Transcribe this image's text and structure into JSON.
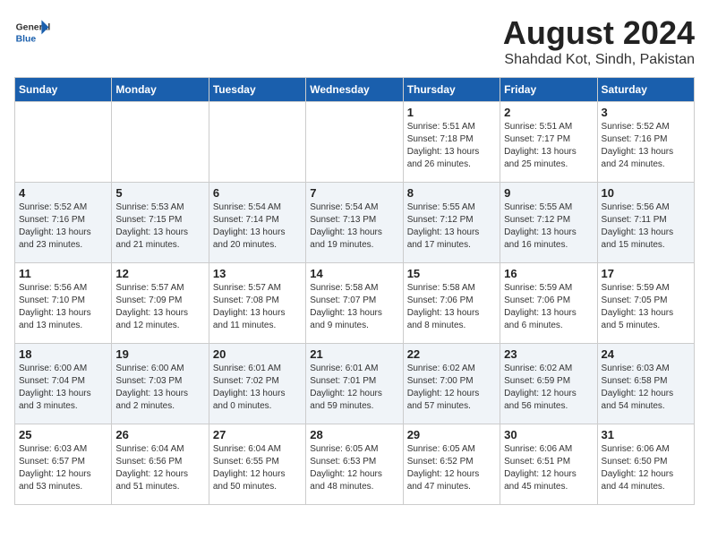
{
  "logo": {
    "general": "General",
    "blue": "Blue"
  },
  "title": "August 2024",
  "subtitle": "Shahdad Kot, Sindh, Pakistan",
  "weekdays": [
    "Sunday",
    "Monday",
    "Tuesday",
    "Wednesday",
    "Thursday",
    "Friday",
    "Saturday"
  ],
  "weeks": [
    [
      {
        "day": "",
        "info": ""
      },
      {
        "day": "",
        "info": ""
      },
      {
        "day": "",
        "info": ""
      },
      {
        "day": "",
        "info": ""
      },
      {
        "day": "1",
        "info": "Sunrise: 5:51 AM\nSunset: 7:18 PM\nDaylight: 13 hours\nand 26 minutes."
      },
      {
        "day": "2",
        "info": "Sunrise: 5:51 AM\nSunset: 7:17 PM\nDaylight: 13 hours\nand 25 minutes."
      },
      {
        "day": "3",
        "info": "Sunrise: 5:52 AM\nSunset: 7:16 PM\nDaylight: 13 hours\nand 24 minutes."
      }
    ],
    [
      {
        "day": "4",
        "info": "Sunrise: 5:52 AM\nSunset: 7:16 PM\nDaylight: 13 hours\nand 23 minutes."
      },
      {
        "day": "5",
        "info": "Sunrise: 5:53 AM\nSunset: 7:15 PM\nDaylight: 13 hours\nand 21 minutes."
      },
      {
        "day": "6",
        "info": "Sunrise: 5:54 AM\nSunset: 7:14 PM\nDaylight: 13 hours\nand 20 minutes."
      },
      {
        "day": "7",
        "info": "Sunrise: 5:54 AM\nSunset: 7:13 PM\nDaylight: 13 hours\nand 19 minutes."
      },
      {
        "day": "8",
        "info": "Sunrise: 5:55 AM\nSunset: 7:12 PM\nDaylight: 13 hours\nand 17 minutes."
      },
      {
        "day": "9",
        "info": "Sunrise: 5:55 AM\nSunset: 7:12 PM\nDaylight: 13 hours\nand 16 minutes."
      },
      {
        "day": "10",
        "info": "Sunrise: 5:56 AM\nSunset: 7:11 PM\nDaylight: 13 hours\nand 15 minutes."
      }
    ],
    [
      {
        "day": "11",
        "info": "Sunrise: 5:56 AM\nSunset: 7:10 PM\nDaylight: 13 hours\nand 13 minutes."
      },
      {
        "day": "12",
        "info": "Sunrise: 5:57 AM\nSunset: 7:09 PM\nDaylight: 13 hours\nand 12 minutes."
      },
      {
        "day": "13",
        "info": "Sunrise: 5:57 AM\nSunset: 7:08 PM\nDaylight: 13 hours\nand 11 minutes."
      },
      {
        "day": "14",
        "info": "Sunrise: 5:58 AM\nSunset: 7:07 PM\nDaylight: 13 hours\nand 9 minutes."
      },
      {
        "day": "15",
        "info": "Sunrise: 5:58 AM\nSunset: 7:06 PM\nDaylight: 13 hours\nand 8 minutes."
      },
      {
        "day": "16",
        "info": "Sunrise: 5:59 AM\nSunset: 7:06 PM\nDaylight: 13 hours\nand 6 minutes."
      },
      {
        "day": "17",
        "info": "Sunrise: 5:59 AM\nSunset: 7:05 PM\nDaylight: 13 hours\nand 5 minutes."
      }
    ],
    [
      {
        "day": "18",
        "info": "Sunrise: 6:00 AM\nSunset: 7:04 PM\nDaylight: 13 hours\nand 3 minutes."
      },
      {
        "day": "19",
        "info": "Sunrise: 6:00 AM\nSunset: 7:03 PM\nDaylight: 13 hours\nand 2 minutes."
      },
      {
        "day": "20",
        "info": "Sunrise: 6:01 AM\nSunset: 7:02 PM\nDaylight: 13 hours\nand 0 minutes."
      },
      {
        "day": "21",
        "info": "Sunrise: 6:01 AM\nSunset: 7:01 PM\nDaylight: 12 hours\nand 59 minutes."
      },
      {
        "day": "22",
        "info": "Sunrise: 6:02 AM\nSunset: 7:00 PM\nDaylight: 12 hours\nand 57 minutes."
      },
      {
        "day": "23",
        "info": "Sunrise: 6:02 AM\nSunset: 6:59 PM\nDaylight: 12 hours\nand 56 minutes."
      },
      {
        "day": "24",
        "info": "Sunrise: 6:03 AM\nSunset: 6:58 PM\nDaylight: 12 hours\nand 54 minutes."
      }
    ],
    [
      {
        "day": "25",
        "info": "Sunrise: 6:03 AM\nSunset: 6:57 PM\nDaylight: 12 hours\nand 53 minutes."
      },
      {
        "day": "26",
        "info": "Sunrise: 6:04 AM\nSunset: 6:56 PM\nDaylight: 12 hours\nand 51 minutes."
      },
      {
        "day": "27",
        "info": "Sunrise: 6:04 AM\nSunset: 6:55 PM\nDaylight: 12 hours\nand 50 minutes."
      },
      {
        "day": "28",
        "info": "Sunrise: 6:05 AM\nSunset: 6:53 PM\nDaylight: 12 hours\nand 48 minutes."
      },
      {
        "day": "29",
        "info": "Sunrise: 6:05 AM\nSunset: 6:52 PM\nDaylight: 12 hours\nand 47 minutes."
      },
      {
        "day": "30",
        "info": "Sunrise: 6:06 AM\nSunset: 6:51 PM\nDaylight: 12 hours\nand 45 minutes."
      },
      {
        "day": "31",
        "info": "Sunrise: 6:06 AM\nSunset: 6:50 PM\nDaylight: 12 hours\nand 44 minutes."
      }
    ]
  ]
}
